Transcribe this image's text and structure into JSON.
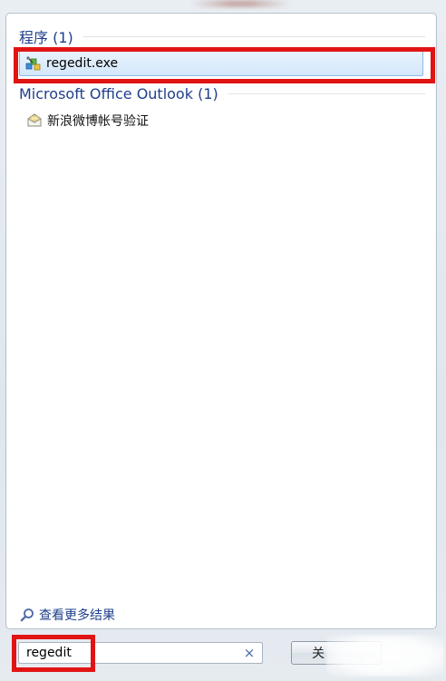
{
  "groups": [
    {
      "header": "程序 (1)",
      "items": [
        {
          "label": "regedit.exe",
          "icon": "registry-editor-icon",
          "selected": true
        }
      ]
    },
    {
      "header": "Microsoft Office Outlook (1)",
      "items": [
        {
          "label": "新浪微博帐号验证",
          "icon": "envelope-icon",
          "selected": false
        }
      ]
    }
  ],
  "see_more": {
    "label": "查看更多结果",
    "icon": "search-icon"
  },
  "search": {
    "value": "regedit",
    "clear_glyph": "×"
  },
  "shutdown_button": {
    "label": "关"
  },
  "colors": {
    "header": "#1e3f8a",
    "highlight": "#e11414",
    "selection_border": "#8db8e8"
  }
}
